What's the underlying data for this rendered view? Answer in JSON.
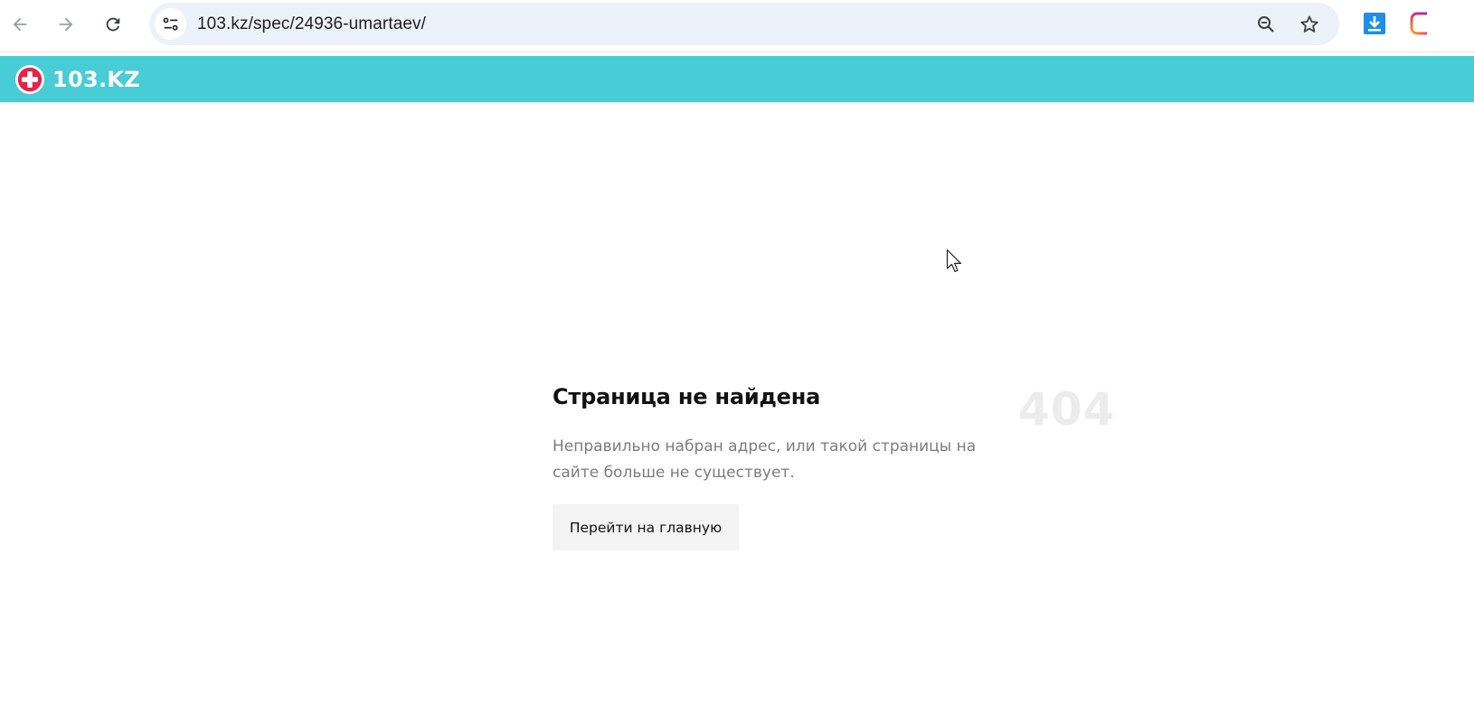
{
  "browser": {
    "url": "103.kz/spec/24936-umartaev/",
    "icons": [
      "back-arrow-icon",
      "forward-arrow-icon",
      "reload-icon",
      "site-settings-icon",
      "zoom-out-icon",
      "bookmark-star-icon",
      "download-extension-icon",
      "instagram-extension-icon"
    ]
  },
  "site": {
    "logo_text": "103.KZ",
    "header_color": "#48ccd6",
    "logo_accent_color": "#e8204a"
  },
  "error": {
    "title": "Страница не найдена",
    "code": "404",
    "description": "Неправильно набран адрес, или такой страницы на сайте больше не существует.",
    "home_button_label": "Перейти на главную"
  }
}
